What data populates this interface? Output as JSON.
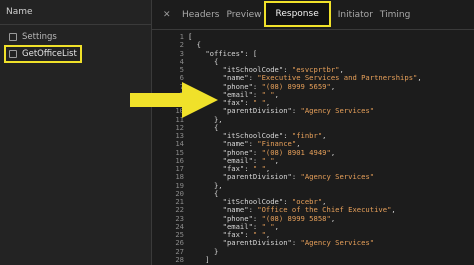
{
  "left_panel": {
    "header": "Name",
    "requests": [
      {
        "label": "Settings"
      },
      {
        "label": "GetOfficeList"
      }
    ]
  },
  "tabs": [
    {
      "label": "Headers"
    },
    {
      "label": "Preview"
    },
    {
      "label": "Response"
    },
    {
      "label": "Initiator"
    },
    {
      "label": "Timing"
    }
  ],
  "active_tab": "Response",
  "code_lines": [
    {
      "n": "1",
      "t": "["
    },
    {
      "n": "2",
      "t": "  {"
    },
    {
      "n": "3",
      "t": "    \"offices\": ["
    },
    {
      "n": "4",
      "t": "      {"
    },
    {
      "n": "5",
      "t": "        \"itSchoolCode\": \"esvcprtbr\","
    },
    {
      "n": "6",
      "t": "        \"name\": \"Executive Services and Partnerships\","
    },
    {
      "n": "7",
      "t": "        \"phone\": \"(08) 8999 5659\","
    },
    {
      "n": "8",
      "t": "        \"email\": \" \","
    },
    {
      "n": "9",
      "t": "        \"fax\": \" \","
    },
    {
      "n": "10",
      "t": "        \"parentDivision\": \"Agency Services\""
    },
    {
      "n": "11",
      "t": "      },"
    },
    {
      "n": "12",
      "t": "      {"
    },
    {
      "n": "13",
      "t": "        \"itSchoolCode\": \"finbr\","
    },
    {
      "n": "14",
      "t": "        \"name\": \"Finance\","
    },
    {
      "n": "15",
      "t": "        \"phone\": \"(08) 8901 4949\","
    },
    {
      "n": "16",
      "t": "        \"email\": \" \","
    },
    {
      "n": "17",
      "t": "        \"fax\": \" \","
    },
    {
      "n": "18",
      "t": "        \"parentDivision\": \"Agency Services\""
    },
    {
      "n": "19",
      "t": "      },"
    },
    {
      "n": "20",
      "t": "      {"
    },
    {
      "n": "21",
      "t": "        \"itSchoolCode\": \"ocebr\","
    },
    {
      "n": "22",
      "t": "        \"name\": \"Office of the Chief Executive\","
    },
    {
      "n": "23",
      "t": "        \"phone\": \"(08) 8999 5858\","
    },
    {
      "n": "24",
      "t": "        \"email\": \" \","
    },
    {
      "n": "25",
      "t": "        \"fax\": \" \","
    },
    {
      "n": "26",
      "t": "        \"parentDivision\": \"Agency Services\""
    },
    {
      "n": "27",
      "t": "      }"
    },
    {
      "n": "28",
      "t": "    ]"
    }
  ],
  "colors": {
    "highlight": "#f0e12a",
    "string": "#e7a05a",
    "key": "#d6d6d6"
  },
  "icons": {
    "close": "close-icon",
    "arrow": "arrow-right-icon"
  }
}
